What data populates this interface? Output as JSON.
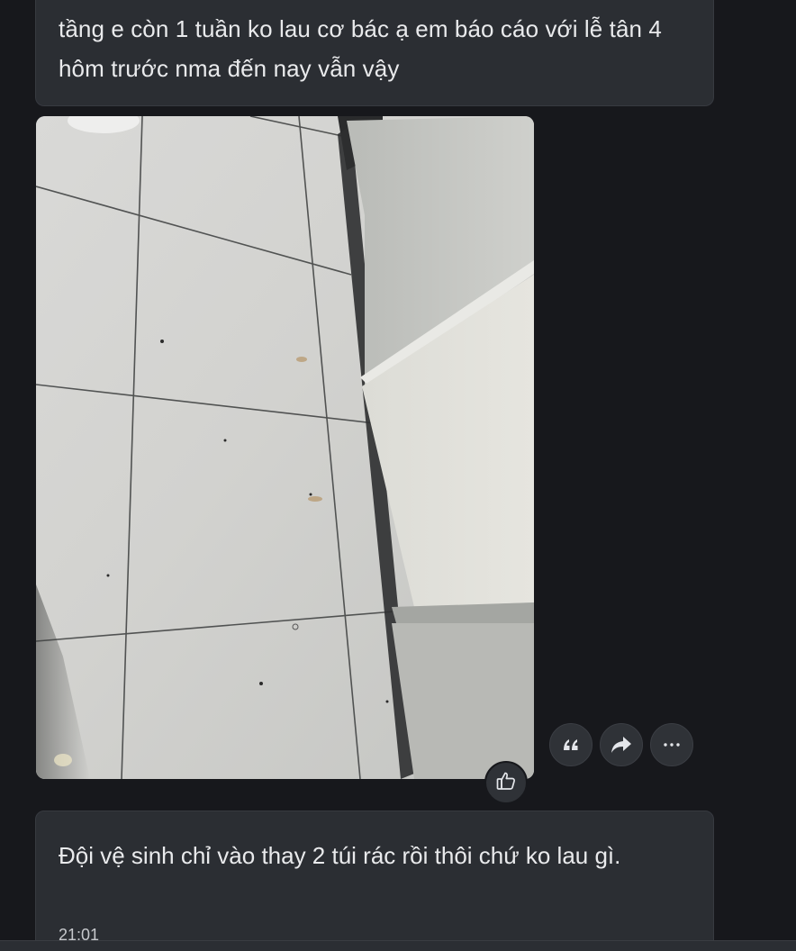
{
  "messages": [
    {
      "type": "text",
      "text": "tầng e còn 1 tuần ko lau cơ bác ạ em báo cáo với lễ tân 4 hôm trước nma đến nay vẫn vậy"
    },
    {
      "type": "image",
      "alt": "photo",
      "actions": [
        {
          "icon": "quote-icon"
        },
        {
          "icon": "forward-icon"
        },
        {
          "icon": "more-icon"
        }
      ],
      "reaction_icon": "thumbs-up-icon"
    },
    {
      "type": "text",
      "text": "Đội vệ sinh chỉ vào thay 2 túi rác rồi thôi chứ ko lau gì.",
      "time": "21:01"
    }
  ],
  "colors": {
    "background": "#17181c",
    "bubble": "#2b2e33",
    "text": "#e9eaec"
  }
}
